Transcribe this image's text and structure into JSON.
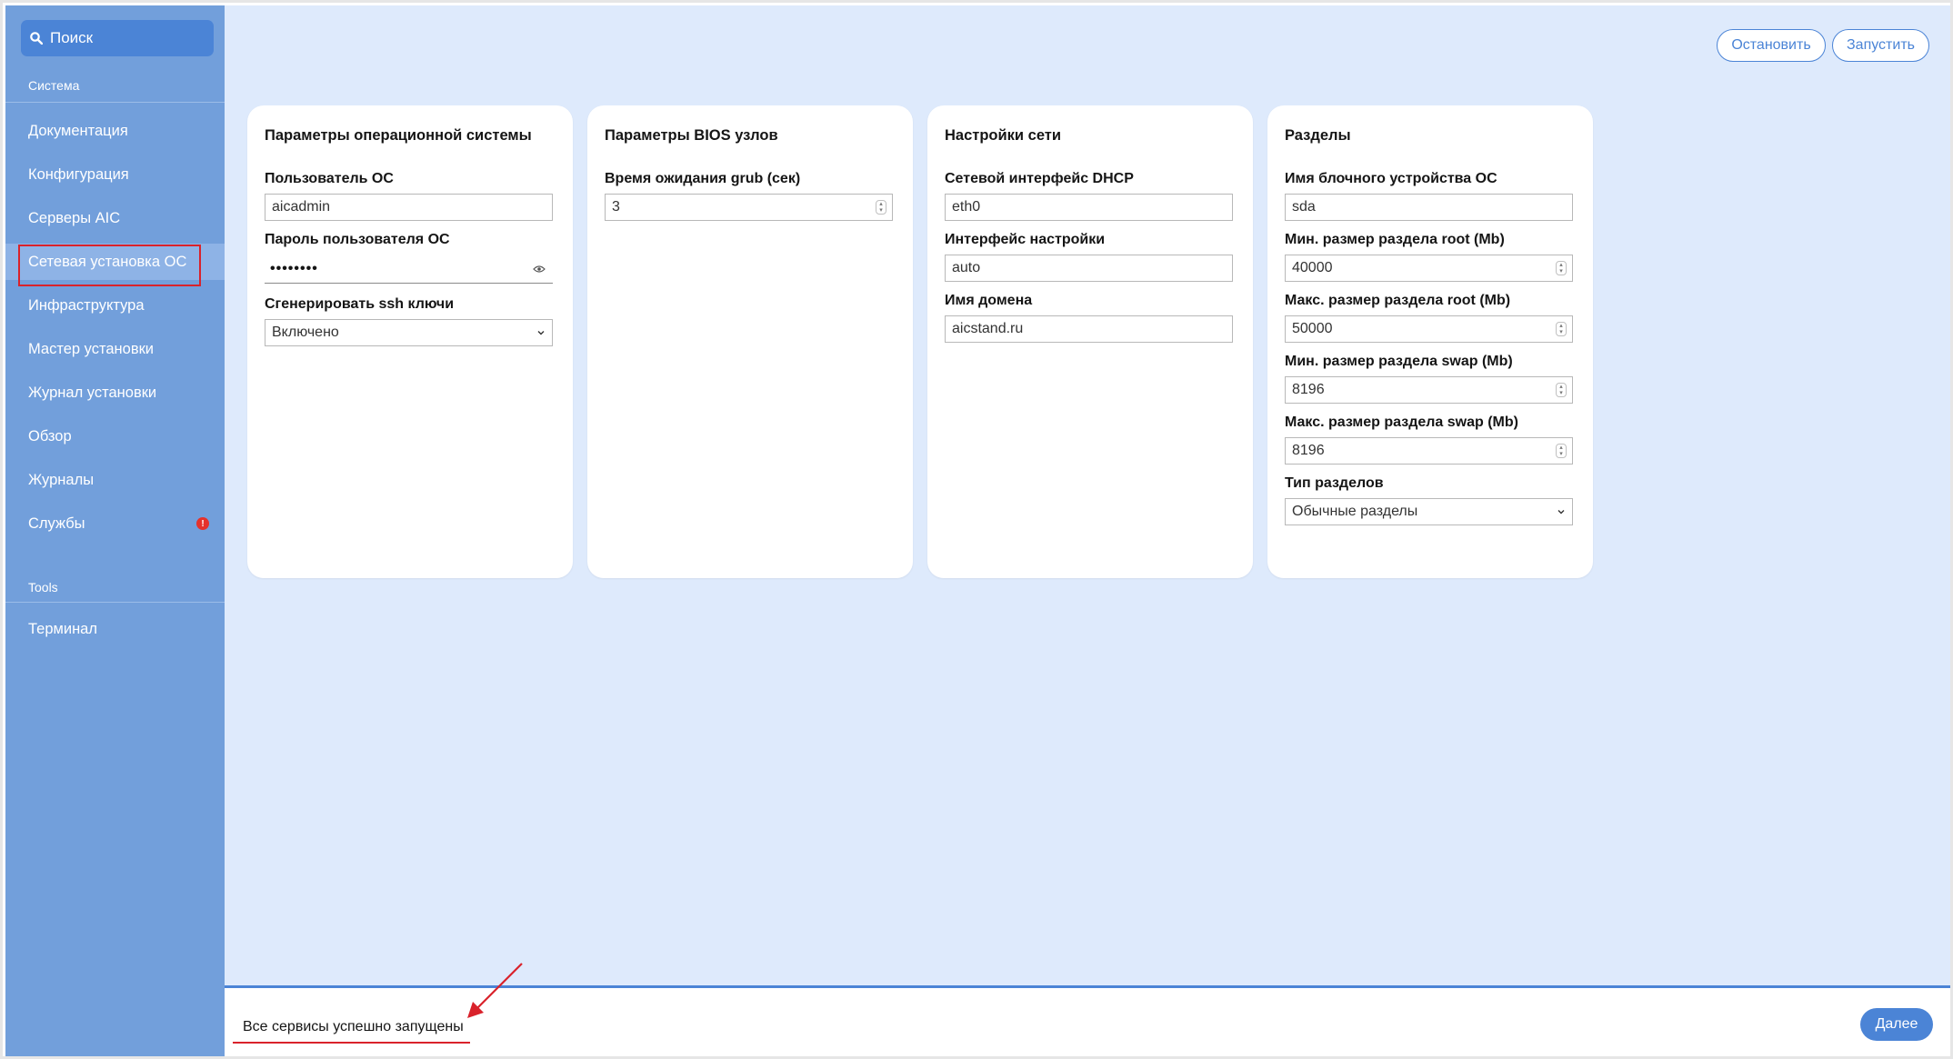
{
  "sidebar": {
    "search_label": "Поиск",
    "section_system": "Система",
    "items": [
      {
        "label": "Документация"
      },
      {
        "label": "Конфигурация"
      },
      {
        "label": "Серверы AIC"
      },
      {
        "label": "Сетевая установка ОС",
        "active": true
      },
      {
        "label": "Инфраструктура"
      },
      {
        "label": "Мастер установки"
      },
      {
        "label": "Журнал установки"
      },
      {
        "label": "Обзор"
      },
      {
        "label": "Журналы"
      },
      {
        "label": "Службы",
        "badge": "!"
      }
    ],
    "section_tools": "Tools",
    "tools_items": [
      {
        "label": "Терминал"
      }
    ]
  },
  "header": {
    "stop_label": "Остановить",
    "start_label": "Запустить"
  },
  "cards": {
    "os": {
      "title": "Параметры операционной системы",
      "user_label": "Пользователь ОС",
      "user_value": "aicadmin",
      "password_label": "Пароль пользователя ОС",
      "password_value": "••••••••",
      "ssh_label": "Сгенерировать ssh ключи",
      "ssh_value": "Включено"
    },
    "bios": {
      "title": "Параметры BIOS узлов",
      "grub_label": "Время ожидания grub (сек)",
      "grub_value": "3"
    },
    "network": {
      "title": "Настройки сети",
      "dhcp_label": "Сетевой интерфейс DHCP",
      "dhcp_value": "eth0",
      "iface_label": "Интерфейс настройки",
      "iface_value": "auto",
      "domain_label": "Имя домена",
      "domain_value": "aicstand.ru"
    },
    "partitions": {
      "title": "Разделы",
      "device_label": "Имя блочного устройства ОС",
      "device_value": "sda",
      "root_min_label": "Мин. размер раздела root (Mb)",
      "root_min_value": "40000",
      "root_max_label": "Макс. размер раздела root (Mb)",
      "root_max_value": "50000",
      "swap_min_label": "Мин. размер раздела swap (Mb)",
      "swap_min_value": "8196",
      "swap_max_label": "Макс. размер раздела swap (Mb)",
      "swap_max_value": "8196",
      "type_label": "Тип разделов",
      "type_value": "Обычные разделы"
    }
  },
  "footer": {
    "status": "Все сервисы успешно запущены",
    "next_label": "Далее"
  },
  "colors": {
    "sidebar": "#729fdb",
    "accent": "#4b84d6",
    "main_bg": "#deeafc",
    "annotation": "#d9222b"
  }
}
